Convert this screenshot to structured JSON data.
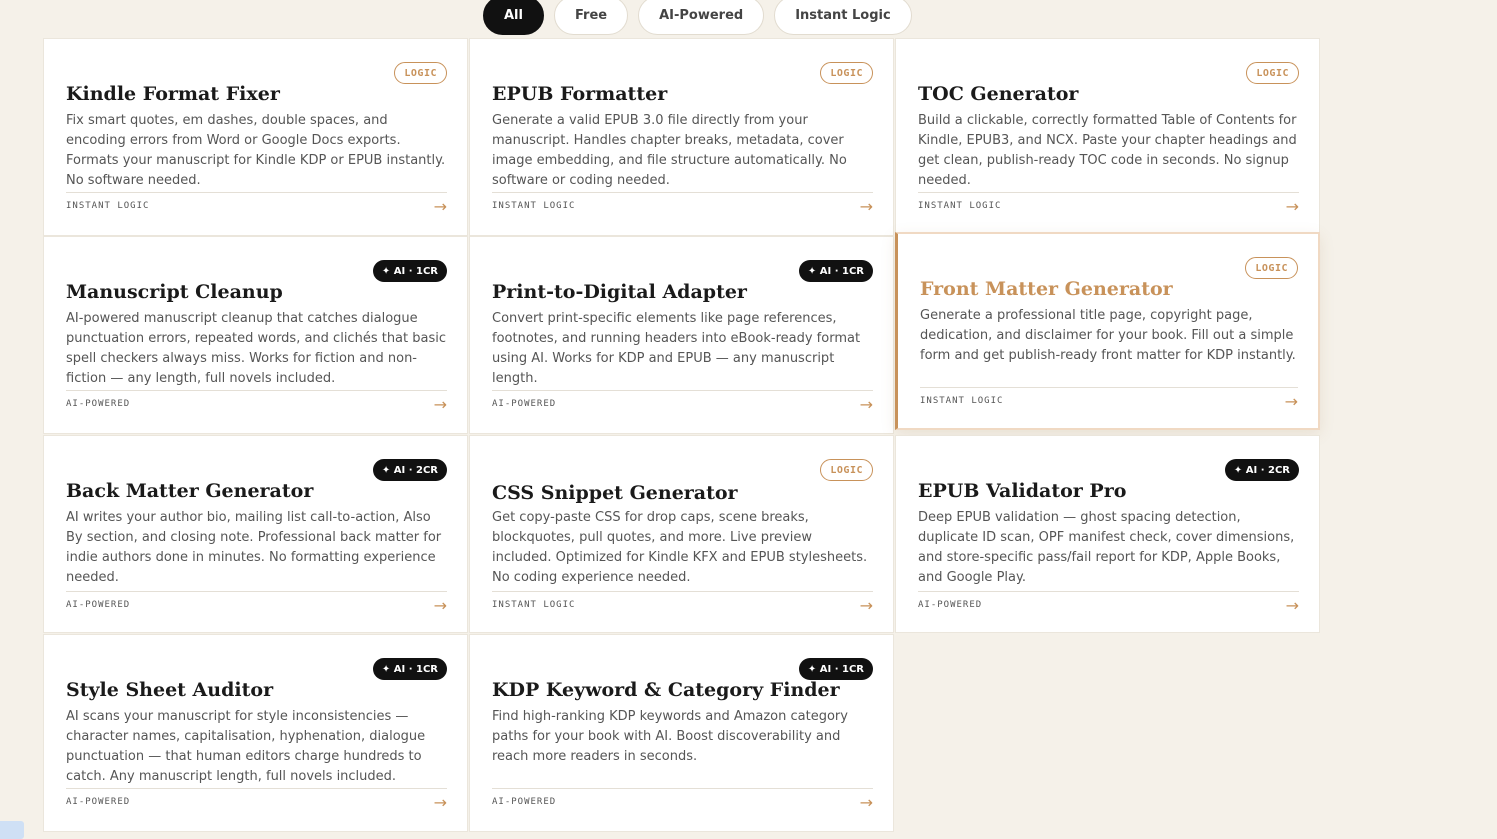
{
  "filters": [
    {
      "label": "All",
      "active": true
    },
    {
      "label": "Free",
      "active": false
    },
    {
      "label": "AI-Powered",
      "active": false
    },
    {
      "label": "Instant Logic",
      "active": false
    }
  ],
  "cards": [
    {
      "badge": "LOGIC",
      "badge_type": "logic",
      "title": "Kindle Format Fixer",
      "desc": "Fix smart quotes, em dashes, double spaces, and encoding errors from Word or Google Docs exports. Formats your manuscript for Kindle KDP or EPUB instantly. No software needed.",
      "footer": "INSTANT LOGIC"
    },
    {
      "badge": "LOGIC",
      "badge_type": "logic",
      "title": "EPUB Formatter",
      "desc": "Generate a valid EPUB 3.0 file directly from your manuscript. Handles chapter breaks, metadata, cover image embedding, and file structure automatically. No software or coding needed.",
      "footer": "INSTANT LOGIC"
    },
    {
      "badge": "LOGIC",
      "badge_type": "logic",
      "title": "TOC Generator",
      "desc": "Build a clickable, correctly formatted Table of Contents for Kindle, EPUB3, and NCX. Paste your chapter headings and get clean, publish-ready TOC code in seconds. No signup needed.",
      "footer": "INSTANT LOGIC"
    },
    {
      "badge": "✦ AI · 1CR",
      "badge_type": "ai",
      "title": "Manuscript Cleanup",
      "desc": "AI-powered manuscript cleanup that catches dialogue punctuation errors, repeated words, and clichés that basic spell checkers always miss. Works for fiction and non-fiction — any length, full novels included.",
      "footer": "AI-POWERED"
    },
    {
      "badge": "✦ AI · 1CR",
      "badge_type": "ai",
      "title": "Print-to-Digital Adapter",
      "desc": "Convert print-specific elements like page references, footnotes, and running headers into eBook-ready format using AI. Works for KDP and EPUB — any manuscript length.",
      "footer": "AI-POWERED"
    },
    {
      "badge": "LOGIC",
      "badge_type": "logic",
      "title": "Front Matter Generator",
      "desc": "Generate a professional title page, copyright page, dedication, and disclaimer for your book. Fill out a simple form and get publish-ready front matter for KDP instantly.",
      "footer": "INSTANT LOGIC",
      "highlight": true
    },
    {
      "badge": "✦ AI · 2CR",
      "badge_type": "ai",
      "title": "Back Matter Generator",
      "desc": "AI writes your author bio, mailing list call-to-action, Also By section, and closing note. Professional back matter for indie authors done in minutes. No formatting experience needed.",
      "footer": "AI-POWERED"
    },
    {
      "badge": "LOGIC",
      "badge_type": "logic",
      "title": "CSS Snippet Generator",
      "desc": "Get copy-paste CSS for drop caps, scene breaks, blockquotes, pull quotes, and more. Live preview included. Optimized for Kindle KFX and EPUB stylesheets. No coding experience needed.",
      "footer": "INSTANT LOGIC"
    },
    {
      "badge": "✦ AI · 2CR",
      "badge_type": "ai",
      "title": "EPUB Validator Pro",
      "desc": "Deep EPUB validation — ghost spacing detection, duplicate ID scan, OPF manifest check, cover dimensions, and store-specific pass/fail report for KDP, Apple Books, and Google Play.",
      "footer": "AI-POWERED"
    },
    {
      "badge": "✦ AI · 1CR",
      "badge_type": "ai",
      "title": "Style Sheet Auditor",
      "desc": "AI scans your manuscript for style inconsistencies — character names, capitalisation, hyphenation, dialogue punctuation — that human editors charge hundreds to catch. Any manuscript length, full novels included.",
      "footer": "AI-POWERED"
    },
    {
      "badge": "✦ AI · 1CR",
      "badge_type": "ai",
      "title": "KDP Keyword & Category Finder",
      "desc": "Find high-ranking KDP keywords and Amazon category paths for your book with AI. Boost discoverability and reach more readers in seconds.",
      "footer": "AI-POWERED"
    }
  ],
  "icons": {
    "arrow": "→"
  },
  "colors": {
    "accent": "#c8925a",
    "background": "#f5f1e9",
    "dark": "#111111"
  }
}
